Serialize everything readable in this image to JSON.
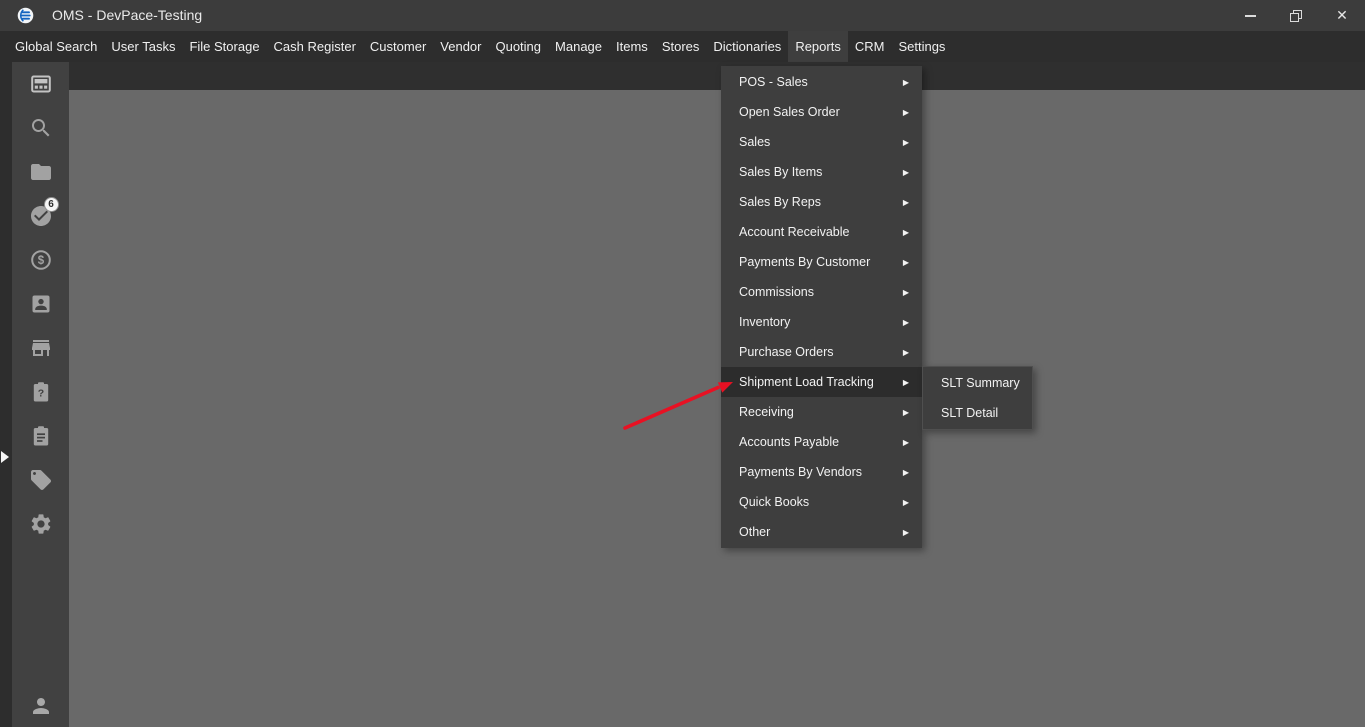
{
  "window": {
    "title": "OMS - DevPace-Testing",
    "controls": {
      "minimize": "minimize",
      "restore": "restore",
      "close_glyph": "✕"
    }
  },
  "menubar": {
    "items": [
      "Global Search",
      "User Tasks",
      "File Storage",
      "Cash Register",
      "Customer",
      "Vendor",
      "Quoting",
      "Manage",
      "Items",
      "Stores",
      "Dictionaries",
      "Reports",
      "CRM",
      "Settings"
    ],
    "active_item": "Reports"
  },
  "reports_menu": {
    "arrow_glyph": "▶",
    "items": [
      "POS - Sales",
      "Open Sales Order",
      "Sales",
      "Sales By Items",
      "Sales By Reps",
      "Account Receivable",
      "Payments By Customer",
      "Commissions",
      "Inventory",
      "Purchase Orders",
      "Shipment Load Tracking",
      "Receiving",
      "Accounts Payable",
      "Payments By Vendors",
      "Quick Books",
      "Other"
    ],
    "highlighted_item": "Shipment Load Tracking"
  },
  "slt_submenu": {
    "items": [
      "SLT Summary",
      "SLT Detail"
    ]
  },
  "sidebar": {
    "icons": [
      {
        "name": "grid-icon"
      },
      {
        "name": "search-icon"
      },
      {
        "name": "folder-icon"
      },
      {
        "name": "tasks-check-icon",
        "badge": "6"
      },
      {
        "name": "dollar-circle-icon"
      },
      {
        "name": "contact-card-icon"
      },
      {
        "name": "storefront-icon"
      },
      {
        "name": "clipboard-question-icon"
      },
      {
        "name": "clipboard-list-icon"
      },
      {
        "name": "tag-icon"
      },
      {
        "name": "gear-icon"
      }
    ],
    "bottom_icon": {
      "name": "person-icon"
    },
    "expander_icon": "right-triangle"
  },
  "annotation": {
    "arrow_color": "#e81123",
    "points_to": "Shipment Load Tracking"
  },
  "colors": {
    "titlebar": "#3c3c3c",
    "menubar": "#2d2d2d",
    "panel": "#3e3e3e",
    "highlight_row": "#2c2c2c",
    "sidebar": "#414141",
    "rail": "#2d2d2d",
    "top_strip": "#2f2f2f",
    "content": "#696969",
    "icon": "#a2a2a2",
    "text": "#f2f2f2",
    "logo_blue": "#1565c0"
  }
}
